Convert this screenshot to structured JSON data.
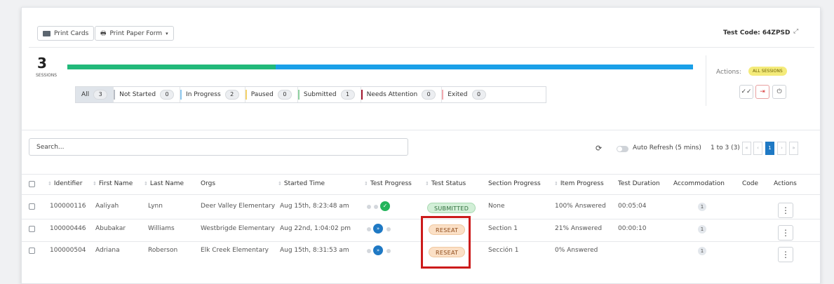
{
  "toolbar": {
    "print_cards": "Print Cards",
    "print_paper_form": "Print Paper Form",
    "test_code": "Test Code: 64ZPSD"
  },
  "sessions": {
    "count": "3",
    "label": "SESSIONS"
  },
  "progress_bar": {
    "submitted_fraction": 0.333,
    "in_progress_fraction": 0.667,
    "colors": {
      "submitted": "#21b97a",
      "in_progress": "#1aa0e8"
    }
  },
  "filters": [
    {
      "label": "All",
      "count": "3",
      "color": ""
    },
    {
      "label": "Not Started",
      "count": "0",
      "color": "#b8bdc4"
    },
    {
      "label": "In Progress",
      "count": "2",
      "color": "#8ec9f0"
    },
    {
      "label": "Paused",
      "count": "0",
      "color": "#f5d36a"
    },
    {
      "label": "Submitted",
      "count": "1",
      "color": "#8fd1a0"
    },
    {
      "label": "Needs Attention",
      "count": "0",
      "color": "#a4172e"
    },
    {
      "label": "Exited",
      "count": "0",
      "color": "#f1a9b0"
    }
  ],
  "actions": {
    "label": "Actions:",
    "all_sessions": "ALL SESSIONS"
  },
  "search": {
    "placeholder": "Search..."
  },
  "refresh": {
    "label": "Auto Refresh (5 mins)",
    "range": "1 to 3 (3)",
    "page": "1"
  },
  "columns": [
    "Identifier",
    "First Name",
    "Last Name",
    "Orgs",
    "Started Time",
    "Test Progress",
    "Test Status",
    "Section Progress",
    "Item Progress",
    "Test Duration",
    "Accommodation",
    "Code",
    "Actions"
  ],
  "rows": [
    {
      "identifier": "100000116",
      "first": "Aaliyah",
      "last": "Lynn",
      "org": "Deer Valley Elementary",
      "started": "Aug 15th, 8:23:48 am",
      "status": "SUBMITTED",
      "section": "None",
      "item": "100% Answered",
      "duration": "00:05:04",
      "accommodation": "1"
    },
    {
      "identifier": "100000446",
      "first": "Abubakar",
      "last": "Williams",
      "org": "Westbrigde Elementary",
      "started": "Aug 22nd, 1:04:02 pm",
      "status": "RESEAT",
      "section": "Section 1",
      "item": "21% Answered",
      "duration": "00:00:10",
      "accommodation": "1"
    },
    {
      "identifier": "100000504",
      "first": "Adriana",
      "last": "Roberson",
      "org": "Elk Creek Elementary",
      "started": "Aug 15th, 8:31:53 am",
      "status": "RESEAT",
      "section": "Sección 1",
      "item": "0% Answered",
      "duration": "",
      "accommodation": "1"
    }
  ],
  "highlight_color": "#cc1b1b"
}
